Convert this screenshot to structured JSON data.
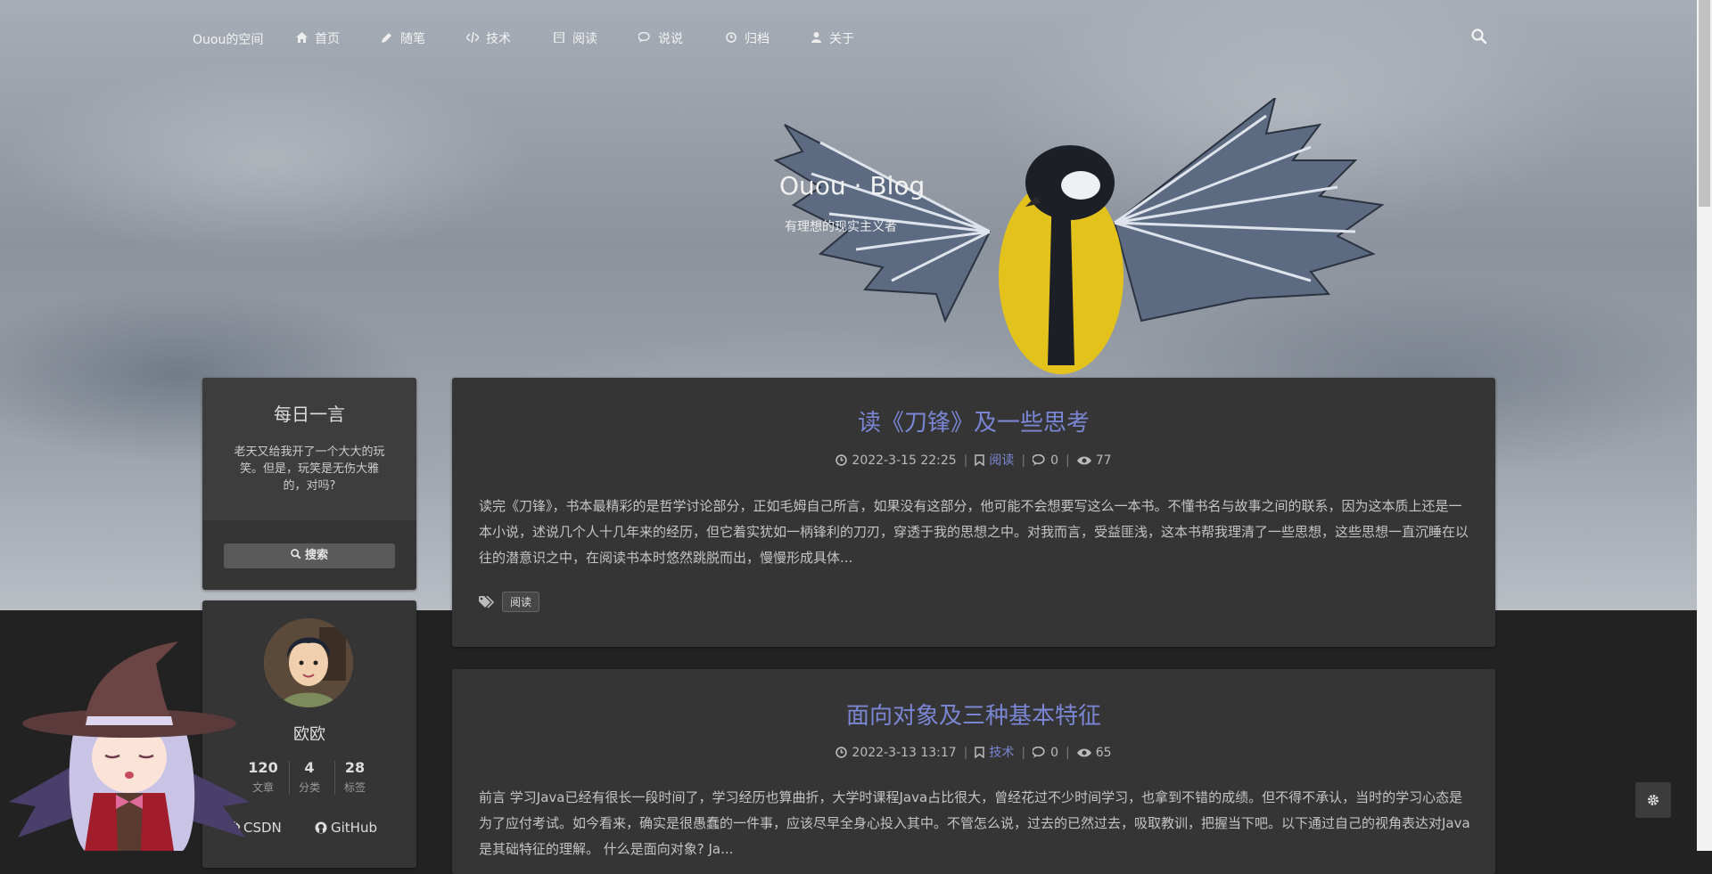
{
  "nav": {
    "brand": "Ouou的空间",
    "items": [
      {
        "label": "首页",
        "icon": "home-icon"
      },
      {
        "label": "随笔",
        "icon": "pencil-icon"
      },
      {
        "label": "技术",
        "icon": "code-icon"
      },
      {
        "label": "阅读",
        "icon": "book-icon"
      },
      {
        "label": "说说",
        "icon": "comments-icon"
      },
      {
        "label": "归档",
        "icon": "clock-icon"
      },
      {
        "label": "关于",
        "icon": "user-icon"
      }
    ],
    "search_icon": "search-icon"
  },
  "hero": {
    "title": "Ouou · Blog",
    "subtitle": "有理想的现实主义者"
  },
  "sidebar": {
    "quote": {
      "title": "每日一言",
      "text": "老天又给我开了一个大大的玩笑。但是，玩笑是无伤大雅的，对吗?",
      "search_label": "搜索"
    },
    "profile": {
      "name": "欧欧",
      "stats": [
        {
          "value": "120",
          "label": "文章"
        },
        {
          "value": "4",
          "label": "分类"
        },
        {
          "value": "28",
          "label": "标签"
        }
      ],
      "links": [
        {
          "label": "CSDN",
          "icon": "code-icon"
        },
        {
          "label": "GitHub",
          "icon": "github-icon"
        }
      ]
    }
  },
  "posts": [
    {
      "title": "读《刀锋》及一些思考",
      "date": "2022-3-15 22:25",
      "category": "阅读",
      "comments": "0",
      "views": "77",
      "excerpt": "读完《刀锋》，书本最精彩的是哲学讨论部分，正如毛姆自己所言，如果没有这部分，他可能不会想要写这么一本书。不懂书名与故事之间的联系，因为这本质上还是一本小说，述说几个人十几年来的经历，但它着实犹如一柄锋利的刀刃，穿透于我的思想之中。对我而言，受益匪浅，这本书帮我理清了一些思想，这些思想一直沉睡在以往的潜意识之中，在阅读书本时悠然跳脱而出，慢慢形成具体...",
      "tags": [
        "阅读"
      ]
    },
    {
      "title": "面向对象及三种基本特征",
      "date": "2022-3-13 13:17",
      "category": "技术",
      "comments": "0",
      "views": "65",
      "excerpt": "前言 学习Java已经有很长一段时间了，学习经历也算曲折，大学时课程Java占比很大，曾经花过不少时间学习，也拿到不错的成绩。但不得不承认，当时的学习心态是为了应付考试。如今看来，确实是很愚蠢的一件事，应该尽早全身心投入其中。不管怎么说，过去的已然过去，吸取教训，把握当下吧。以下通过自己的视角表达对Java是其础特征的理解。 什么是面向对象? Ja..."
    }
  ],
  "colors": {
    "accent": "#7a86d4",
    "background": "#222222",
    "card": "#353535"
  }
}
